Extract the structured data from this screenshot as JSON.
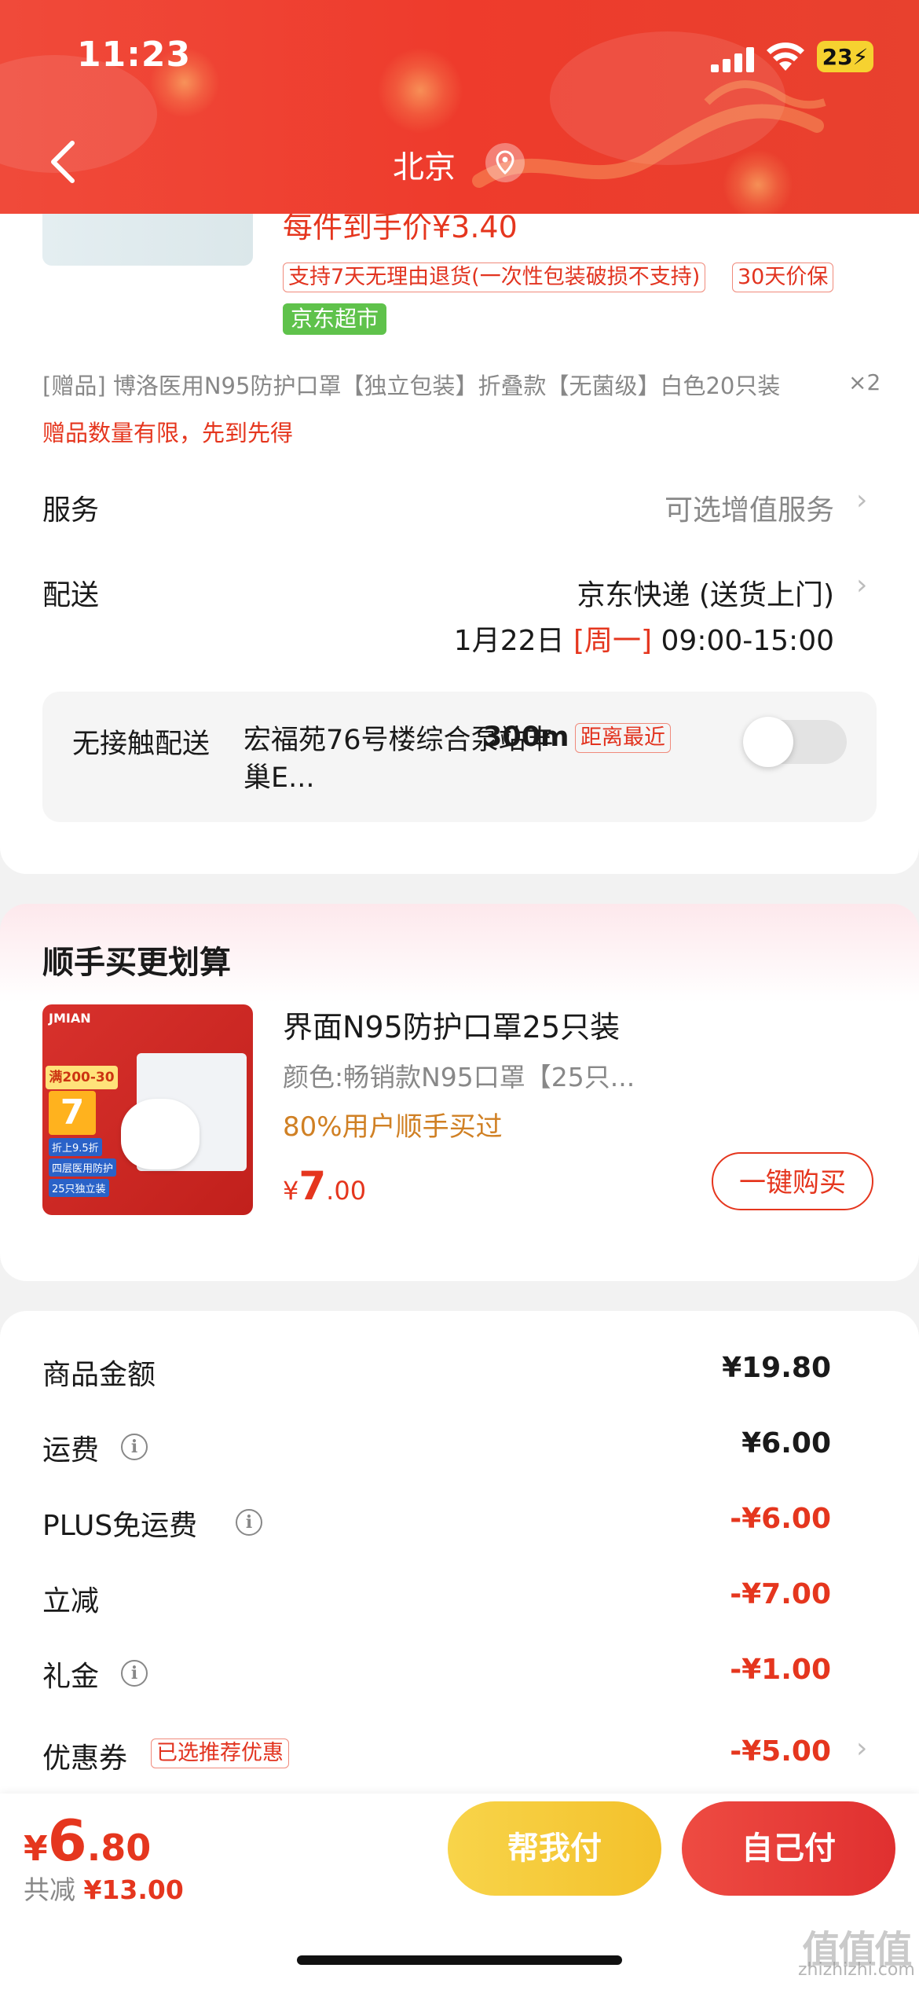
{
  "status_bar": {
    "time": "11:23",
    "battery": "23"
  },
  "header": {
    "title": "北京"
  },
  "product": {
    "price_each": "每件到手价¥3.40",
    "tags": [
      "支持7天无理由退货(一次性包装破损不支持)",
      "30天价保"
    ],
    "store_tag": "京东超市",
    "gift_text": "[赠品] 博洛医用N95防护口罩【独立包装】折叠款【无菌级】白色20只装",
    "gift_qty": "×2",
    "gift_note": "赠品数量有限，先到先得"
  },
  "service": {
    "label": "服务",
    "value": "可选增值服务"
  },
  "delivery": {
    "label": "配送",
    "method": "京东快递 (送货上门)",
    "date": "1月22日",
    "weekday": "[周一]",
    "time": "09:00-15:00"
  },
  "contactless": {
    "label": "无接触配送",
    "locker": "宏福苑76号楼综合泵站丰巢E...",
    "distance": "300m",
    "tag": "距离最近",
    "enabled": false
  },
  "addon": {
    "title": "顺手买更划算",
    "name": "界面N95防护口罩25只装",
    "variant": "颜色:畅销款N95口罩【25只...",
    "social": "80%用户顺手买过",
    "price_currency": "¥",
    "price_int": "7",
    "price_dec": ".00",
    "buy_label": "一键购买",
    "image": {
      "brand": "JMIAN",
      "promo": "满200-30",
      "big": "7",
      "l1": "折上9.5折",
      "l2": "四层医用防护",
      "l3": "25只独立装"
    }
  },
  "summary": {
    "items": [
      {
        "label": "商品金额",
        "value": "¥19.80"
      },
      {
        "label": "运费",
        "value": "¥6.00"
      },
      {
        "label": "PLUS免运费",
        "value": "-¥6.00"
      },
      {
        "label": "立减",
        "value": "-¥7.00"
      },
      {
        "label": "礼金",
        "value": "-¥1.00"
      },
      {
        "label": "优惠券",
        "value": "-¥5.00",
        "tag": "已选推荐优惠"
      }
    ]
  },
  "footer": {
    "total_currency": "¥",
    "total_int": "6",
    "total_dec": ".80",
    "discount_label": "共减",
    "discount_value": "¥13.00",
    "help_pay": "帮我付",
    "self_pay": "自己付"
  },
  "watermark": {
    "logo": "值值值",
    "site": "zhizhizhi.com"
  },
  "colors": {
    "primary_red": "#e5361e",
    "header_red": "#ee3b2c",
    "green_tag": "#5fc24b",
    "help_yellow": "#f3c12b"
  }
}
